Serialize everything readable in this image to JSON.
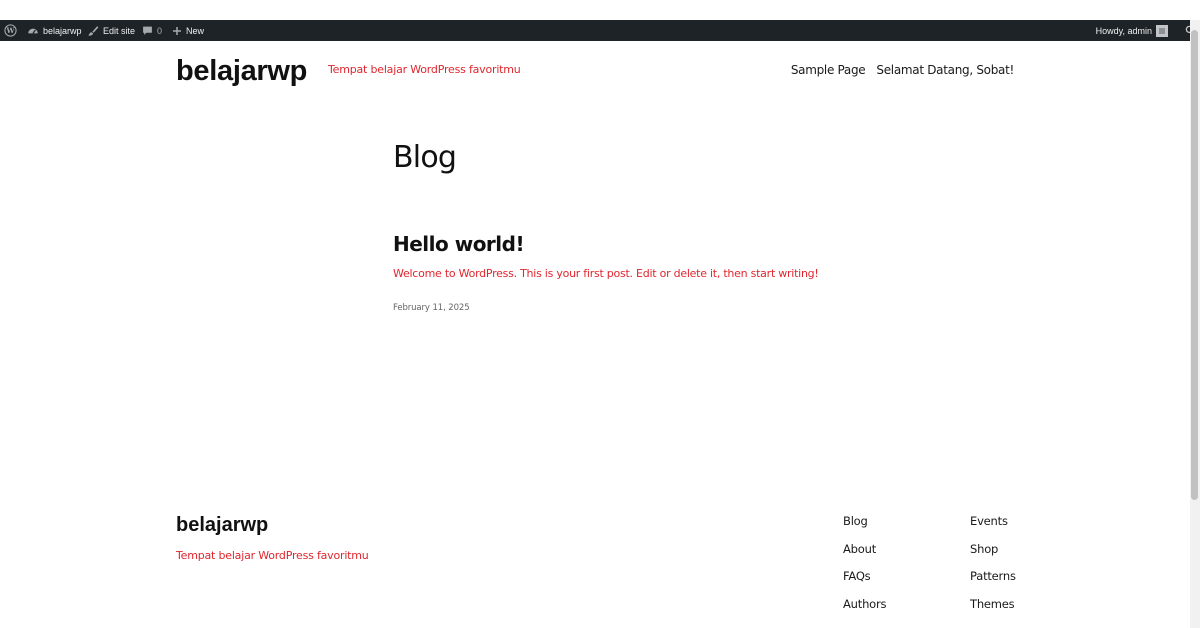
{
  "admin_bar": {
    "site_name": "belajarwp",
    "edit_site": "Edit site",
    "comments_count": "0",
    "new_label": "New",
    "howdy": "Howdy, admin"
  },
  "header": {
    "site_title": "belajarwp",
    "tagline": "Tempat belajar WordPress favoritmu",
    "nav": [
      "Sample Page",
      "Selamat Datang, Sobat!"
    ]
  },
  "main": {
    "page_title": "Blog",
    "post": {
      "title": "Hello world!",
      "excerpt": "Welcome to WordPress. This is your first post. Edit or delete it, then start writing!",
      "date": "February 11, 2025"
    }
  },
  "footer": {
    "site_title": "belajarwp",
    "tagline": "Tempat belajar WordPress favoritmu",
    "col1": [
      "Blog",
      "About",
      "FAQs",
      "Authors"
    ],
    "col2": [
      "Events",
      "Shop",
      "Patterns",
      "Themes"
    ]
  },
  "colors": {
    "admin_bar_bg": "#1d2327",
    "accent": "#e0262e"
  },
  "icons": [
    "wordpress-logo-icon",
    "dashboard-icon",
    "brush-icon",
    "comment-icon",
    "plus-icon",
    "search-icon"
  ]
}
